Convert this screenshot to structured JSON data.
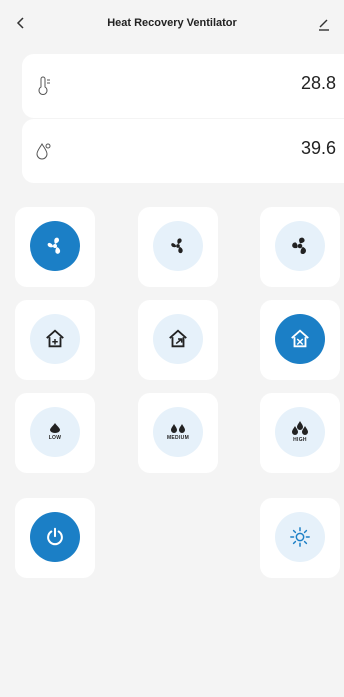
{
  "header": {
    "title": "Heat Recovery Ventilator",
    "back_icon": "chevron-left-icon",
    "edit_icon": "edit-pencil-icon"
  },
  "readings": [
    {
      "name": "temperature",
      "icon": "thermometer-icon",
      "value": "28.8"
    },
    {
      "name": "humidity",
      "icon": "humidity-drop-icon",
      "value": "39.6"
    }
  ],
  "fan_speeds": [
    {
      "name": "fan-low",
      "icon": "fan-icon",
      "active": true
    },
    {
      "name": "fan-medium",
      "icon": "fan-icon",
      "active": false
    },
    {
      "name": "fan-high",
      "icon": "fan-icon",
      "active": false
    }
  ],
  "modes": [
    {
      "name": "mode-home-inward",
      "icon": "home-arrow-icon",
      "active": false
    },
    {
      "name": "mode-home-outward",
      "icon": "home-arrow-icon",
      "active": false
    },
    {
      "name": "mode-home-exchange",
      "icon": "home-arrow-icon",
      "active": true
    }
  ],
  "humidity_levels": [
    {
      "name": "humidity-low",
      "icon": "drop-low-icon",
      "label": "LOW",
      "active": false
    },
    {
      "name": "humidity-medium",
      "icon": "drop-medium-icon",
      "label": "MEDIUM",
      "active": false
    },
    {
      "name": "humidity-high",
      "icon": "drop-high-icon",
      "label": "HIGH",
      "active": false
    }
  ],
  "controls": {
    "power_icon": "power-icon",
    "power_active": true,
    "light_icon": "sun-icon",
    "light_active": false
  },
  "colors": {
    "accent": "#1b7fc6",
    "inactive_circle": "#e6f1fa",
    "background": "#f4f4f4",
    "card": "#ffffff"
  }
}
